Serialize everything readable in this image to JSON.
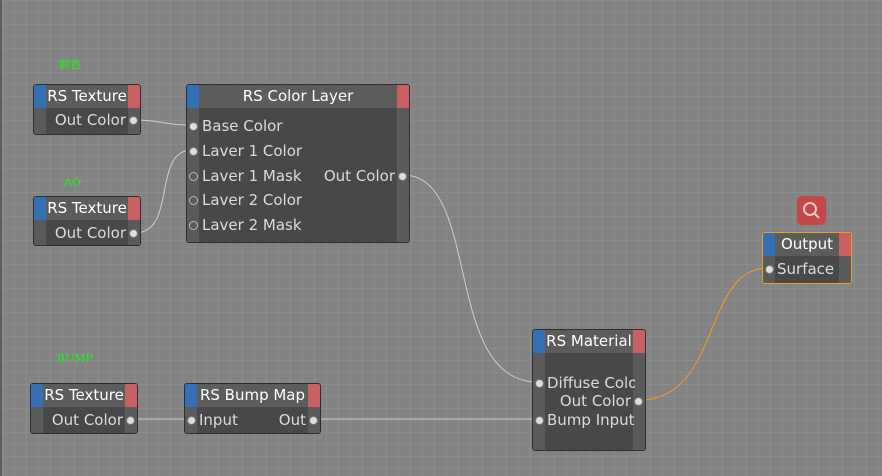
{
  "labels": {
    "color": "颜色",
    "ao": "AO",
    "bump": "BUMP"
  },
  "nodes": {
    "tex1": {
      "title": "RS Texture",
      "out": "Out Color"
    },
    "tex2": {
      "title": "RS Texture",
      "out": "Out Color"
    },
    "tex3": {
      "title": "RS Texture",
      "out": "Out Color"
    },
    "layer": {
      "title": "RS Color Layer",
      "inputs": [
        "Base Color",
        "Laver 1 Color",
        "Laver 1 Mask",
        "Laver 2 Color",
        "Laver 2 Mask"
      ],
      "out": "Out Color"
    },
    "bump": {
      "title": "RS Bump Map",
      "in": "Input",
      "out": "Out"
    },
    "material": {
      "title": "RS Material",
      "in1": "Diffuse Colo",
      "out": "Out Color",
      "in2": "Bump Input"
    },
    "output": {
      "title": "Output",
      "in": "Surface"
    }
  },
  "colors": {
    "wire": "#cfcfcf",
    "active_wire": "#f0a020",
    "label": "#22ee22"
  }
}
